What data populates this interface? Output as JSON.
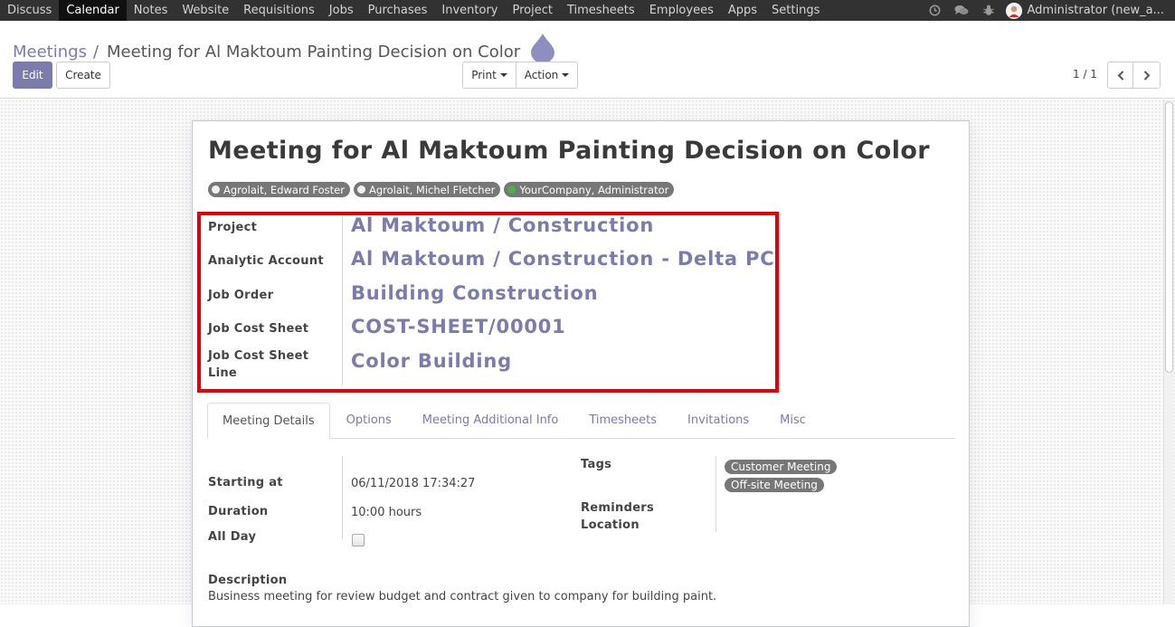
{
  "navbar": {
    "menu": [
      "Discuss",
      "Calendar",
      "Notes",
      "Website",
      "Requisitions",
      "Jobs",
      "Purchases",
      "Inventory",
      "Project",
      "Timesheets",
      "Employees",
      "Apps",
      "Settings"
    ],
    "active_item": "Calendar",
    "user_label": "Administrator (new_a..."
  },
  "breadcrumb": {
    "parent": "Meetings",
    "separator": "/",
    "current": "Meeting for Al Maktoum Painting Decision on Color"
  },
  "toolbar": {
    "edit_label": "Edit",
    "create_label": "Create",
    "print_label": "Print",
    "action_label": "Action"
  },
  "pager": {
    "value": "1 / 1"
  },
  "record": {
    "title": "Meeting for Al Maktoum Painting Decision on Color",
    "attendees": [
      {
        "name": "Agrolait, Edward Foster",
        "status": "white"
      },
      {
        "name": "Agrolait, Michel Fletcher",
        "status": "white"
      },
      {
        "name": "YourCompany, Administrator",
        "status": "green"
      }
    ],
    "fields": {
      "project": {
        "label": "Project",
        "value": "Al Maktoum / Construction"
      },
      "analytic_account": {
        "label": "Analytic Account",
        "value": "Al Maktoum / Construction - Delta PC"
      },
      "job_order": {
        "label": "Job Order",
        "value": "Building Construction"
      },
      "job_cost_sheet": {
        "label": "Job Cost Sheet",
        "value": "COST-SHEET/00001"
      },
      "job_cost_sheet_line": {
        "label_line1": "Job Cost Sheet",
        "label_line2": "Line",
        "value": "Color Building"
      }
    }
  },
  "tabs": [
    "Meeting Details",
    "Options",
    "Meeting Additional Info",
    "Timesheets",
    "Invitations",
    "Misc"
  ],
  "active_tab": "Meeting Details",
  "details": {
    "starting_at": {
      "label": "Starting at",
      "value": "06/11/2018 17:34:27"
    },
    "duration": {
      "label": "Duration",
      "value": "10:00 hours"
    },
    "all_day": {
      "label": "All Day",
      "checked": false
    },
    "tags": {
      "label": "Tags",
      "values": [
        "Customer Meeting",
        "Off-site Meeting"
      ]
    },
    "reminders": {
      "label": "Reminders"
    },
    "location": {
      "label": "Location"
    },
    "description": {
      "label": "Description",
      "value": "Business meeting for review budget  and contract given to company for building paint."
    }
  },
  "colors": {
    "brand": "#7c7bad",
    "navbar": "#323232",
    "highlight": "#e0000b"
  }
}
